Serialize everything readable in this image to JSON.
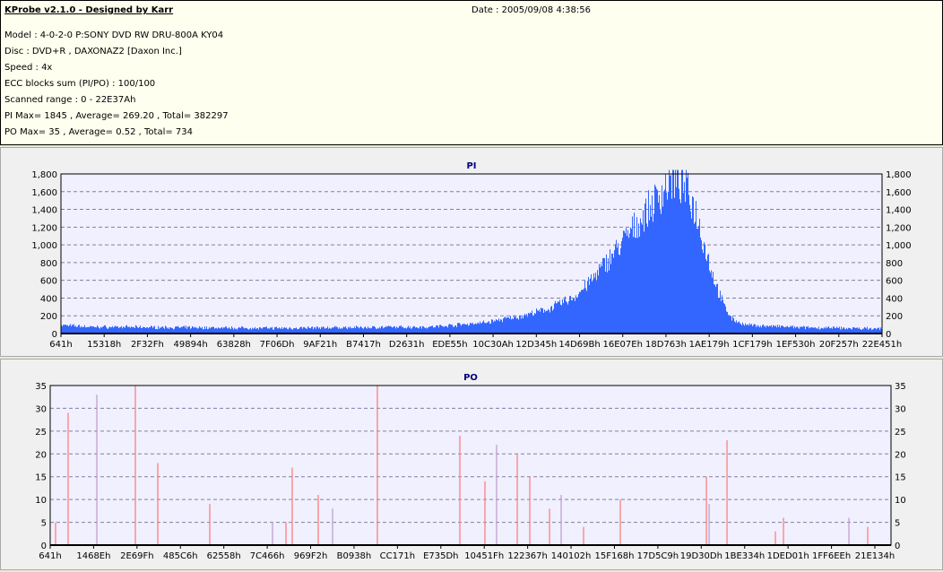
{
  "header": {
    "title": "KProbe v2.1.0 - Designed by Karr",
    "date": "Date : 2005/09/08 4:38:56",
    "lines": [
      "Model : 4-0-2-0 P:SONY    DVD RW DRU-800A  KY04",
      "Disc : DVD+R , DAXONAZ2 [Daxon Inc.]",
      "Speed : 4x",
      "ECC blocks sum (PI/PO) : 100/100",
      "Scanned range : 0 - 22E37Ah",
      "PI Max= 1845 , Average= 269.20 , Total= 382297",
      "PO Max= 35 , Average= 0.52 , Total= 734"
    ]
  },
  "chart_data": [
    {
      "type": "bar",
      "title": "PI",
      "color": "#3366ff",
      "ylim": [
        0,
        1800
      ],
      "yticks": [
        "0",
        "200",
        "400",
        "600",
        "800",
        "1,000",
        "1,200",
        "1,400",
        "1,600",
        "1,800"
      ],
      "xlim_lba": [
        1601,
        2286458
      ],
      "xticks": [
        "641h",
        "15318h",
        "2F32Fh",
        "49894h",
        "63828h",
        "7F06Dh",
        "9AF21h",
        "B7417h",
        "D2631h",
        "EDE55h",
        "10C30Ah",
        "12D345h",
        "14D69Bh",
        "16E07Eh",
        "18D763h",
        "1AE179h",
        "1CF179h",
        "1EF530h",
        "20F257h",
        "22E451h"
      ],
      "profile_lba": [
        1601,
        84000,
        582000,
        1032000,
        1181000,
        1281000,
        1356000,
        1431000,
        1480000,
        1530000,
        1580000,
        1630000,
        1667000,
        1693000,
        1718000,
        1743000,
        1768000,
        1793000,
        1818000,
        1843000,
        1868000,
        1905000,
        2078000,
        2286458
      ],
      "profile_values": [
        80,
        60,
        45,
        60,
        110,
        180,
        260,
        400,
        600,
        850,
        1100,
        1350,
        1550,
        1700,
        1720,
        1600,
        1350,
        950,
        600,
        320,
        150,
        80,
        50,
        40
      ],
      "max": 1845
    },
    {
      "type": "bar",
      "title": "PO",
      "color": "#ff7f7f",
      "ylim": [
        0,
        35
      ],
      "yticks": [
        "0",
        "5",
        "10",
        "15",
        "20",
        "25",
        "30",
        "35"
      ],
      "xlim_lba": [
        1601,
        2286458
      ],
      "xticks": [
        "641h",
        "1468Eh",
        "2E69Fh",
        "485C6h",
        "62558h",
        "7C466h",
        "969F2h",
        "B0938h",
        "CC171h",
        "E735Dh",
        "10451Fh",
        "122367h",
        "140102h",
        "15F168h",
        "17D5C9h",
        "19D30Dh",
        "1BE334h",
        "1DED01h",
        "1FF6EEh",
        "21E134h"
      ],
      "spikes_lba": [
        16200,
        50300,
        128300,
        233000,
        294000,
        435200,
        605700,
        642300,
        659300,
        730000,
        769000,
        890700,
        1114800,
        1183000,
        1214700,
        1270800,
        1304900,
        1358500,
        1390100,
        1451000,
        1550900,
        1784800,
        1792100,
        1840800,
        1972300,
        1994200,
        2172100,
        2223200
      ],
      "spikes_values": [
        5,
        29,
        33,
        35,
        18,
        9,
        5,
        5,
        17,
        11,
        8,
        35,
        24,
        14,
        22,
        20,
        15,
        8,
        11,
        4,
        10,
        15,
        9,
        23,
        3,
        6,
        6,
        4
      ]
    }
  ]
}
